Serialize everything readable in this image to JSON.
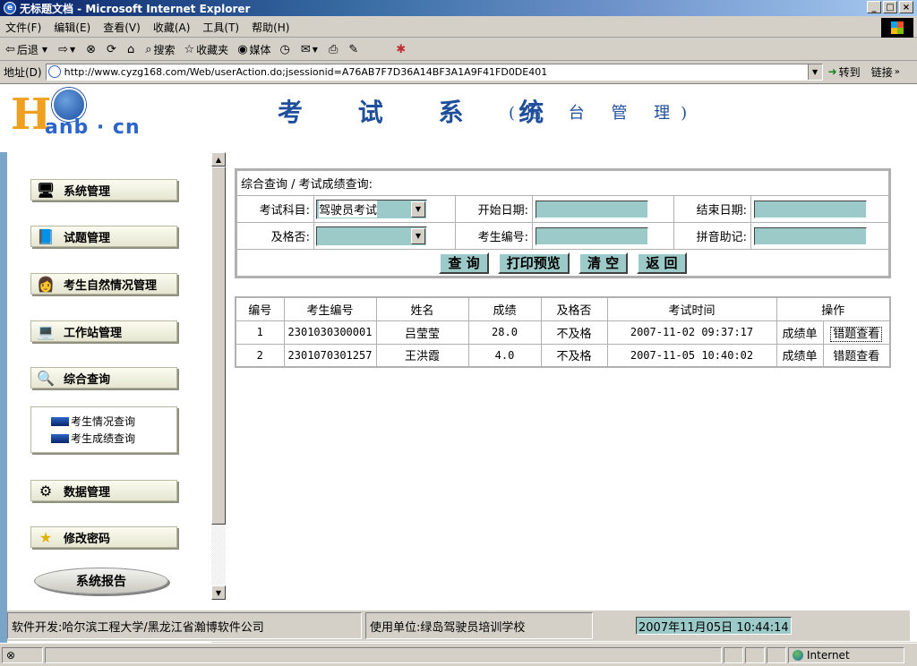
{
  "window": {
    "title": "无标题文档 - Microsoft Internet Explorer",
    "buttons": {
      "minimize": "_",
      "maximize": "□",
      "close": "×"
    }
  },
  "menubar": [
    "文件(F)",
    "编辑(E)",
    "查看(V)",
    "收藏(A)",
    "工具(T)",
    "帮助(H)"
  ],
  "toolbar": {
    "back": "后退",
    "search": "搜索",
    "favorites": "收藏夹",
    "media": "媒体"
  },
  "address": {
    "label": "地址(D)",
    "url": "http://www.cyzg168.com/Web/userAction.do;jsessionid=A76AB7F7D36A14BF3A1A9F41FD0DE401",
    "go": "转到",
    "links": "链接"
  },
  "header": {
    "logo_h": "H",
    "logo_rest": "anb · cn",
    "title": "考 试 系 统",
    "subtitle": "(后 台 管 理)"
  },
  "sidebar": {
    "items": [
      {
        "label": "系统管理",
        "icon": "server-icon"
      },
      {
        "label": "试题管理",
        "icon": "book-icon"
      },
      {
        "label": "考生自然情况管理",
        "icon": "student-icon"
      },
      {
        "label": "工作站管理",
        "icon": "workstation-icon"
      },
      {
        "label": "综合查询",
        "icon": "magnifier-icon"
      },
      {
        "label": "数据管理",
        "icon": "data-icon"
      },
      {
        "label": "修改密码",
        "icon": "star-icon"
      }
    ],
    "sub_items": [
      "考生情况查询",
      "考生成绩查询"
    ],
    "report": "系统报告"
  },
  "query": {
    "breadcrumb": "综合查询 / 考试成绩查询:",
    "subject_label": "考试科目:",
    "subject_value": "驾驶员考试",
    "start_label": "开始日期:",
    "end_label": "结束日期:",
    "pass_label": "及格否:",
    "examinee_label": "考生编号:",
    "pinyin_label": "拼音助记:",
    "buttons": {
      "search": "查 询",
      "print": "打印预览",
      "clear": "清 空",
      "back": "返 回"
    }
  },
  "results": {
    "headers": [
      "编号",
      "考生编号",
      "姓名",
      "成绩",
      "及格否",
      "考试时间",
      "操作"
    ],
    "rows": [
      {
        "no": "1",
        "id": "2301030300001",
        "name": "吕莹莹",
        "score": "28.0",
        "pass": "不及格",
        "time": "2007-11-02 09:37:17",
        "op1": "成绩单",
        "op2": "错题查看"
      },
      {
        "no": "2",
        "id": "2301070301257",
        "name": "王洪霞",
        "score": "4.0",
        "pass": "不及格",
        "time": "2007-11-05 10:40:02",
        "op1": "成绩单",
        "op2": "错题查看"
      }
    ]
  },
  "footer": {
    "developer": "软件开发:哈尔滨工程大学/黑龙江省瀚博软件公司",
    "user": "使用单位:绿岛驾驶员培训学校",
    "clock": "2007年11月05日  10:44:14"
  },
  "status": {
    "zone": "Internet"
  }
}
